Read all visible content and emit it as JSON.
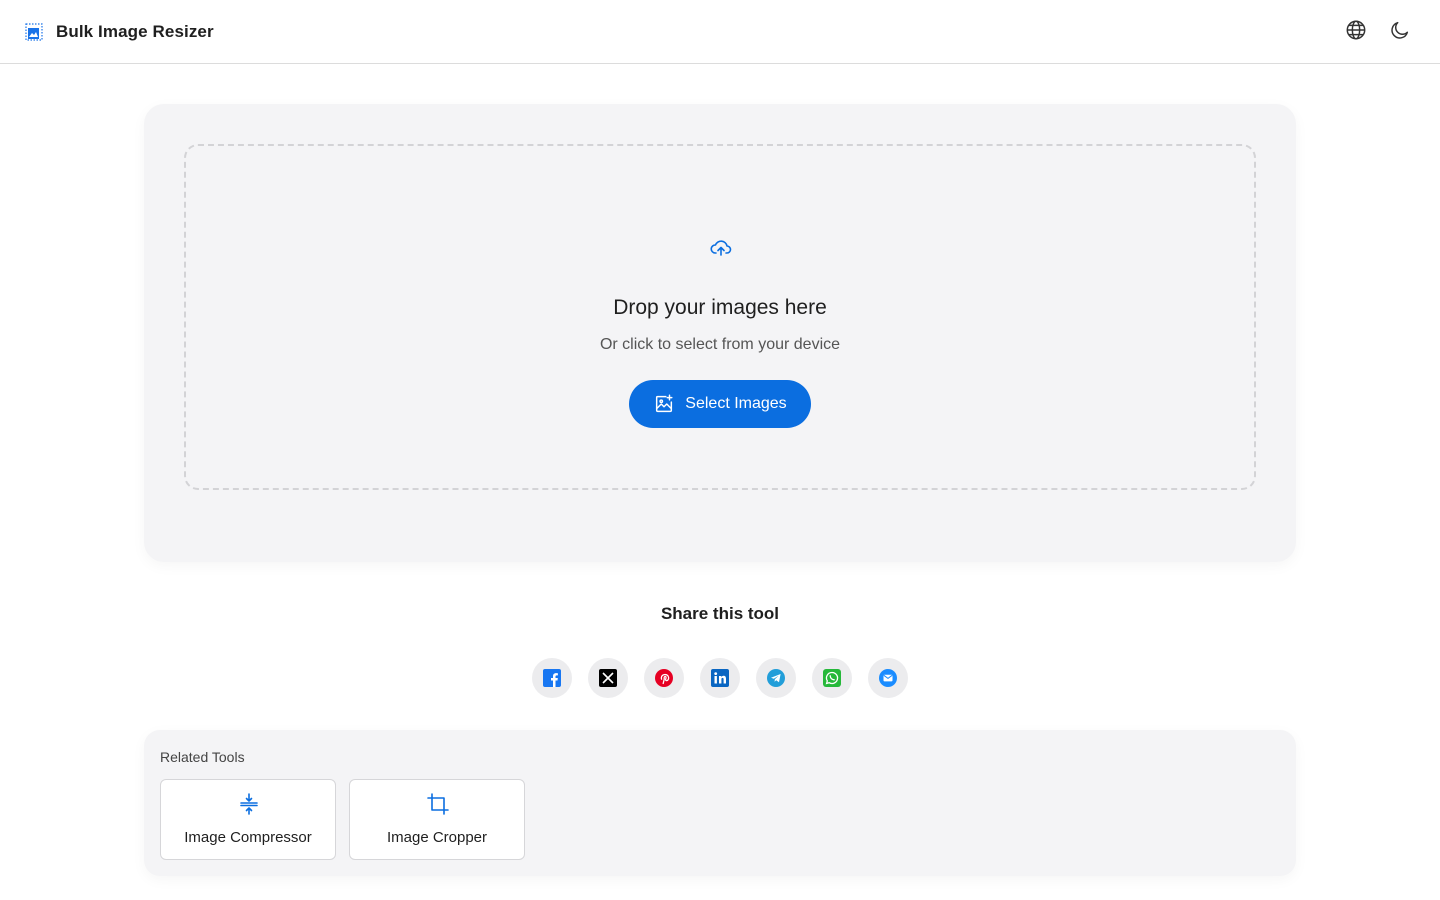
{
  "header": {
    "title": "Bulk Image Resizer",
    "logo_icon": "image-stack-icon",
    "actions": [
      {
        "icon": "globe-icon"
      },
      {
        "icon": "moon-icon"
      }
    ]
  },
  "dropzone": {
    "icon": "cloud-upload-icon",
    "title": "Drop your images here",
    "subtitle": "Or click to select from your device",
    "button_label": "Select Images",
    "button_icon": "add-image-icon"
  },
  "share": {
    "title": "Share this tool",
    "buttons": [
      {
        "network": "facebook",
        "color": "#1877f2"
      },
      {
        "network": "x",
        "color": "#000000"
      },
      {
        "network": "pinterest",
        "color": "#e60023"
      },
      {
        "network": "linkedin",
        "color": "#0a66c2"
      },
      {
        "network": "telegram",
        "color": "#229ed9"
      },
      {
        "network": "whatsapp",
        "color": "#25d366"
      },
      {
        "network": "email",
        "color": "#1a8cff"
      }
    ]
  },
  "related": {
    "title": "Related Tools",
    "tools": [
      {
        "label": "Image Compressor",
        "icon": "compress-icon"
      },
      {
        "label": "Image Cropper",
        "icon": "crop-icon"
      }
    ]
  },
  "colors": {
    "accent": "#0b6ee0",
    "card_bg": "#f4f4f6",
    "border": "#dcdcdc"
  }
}
